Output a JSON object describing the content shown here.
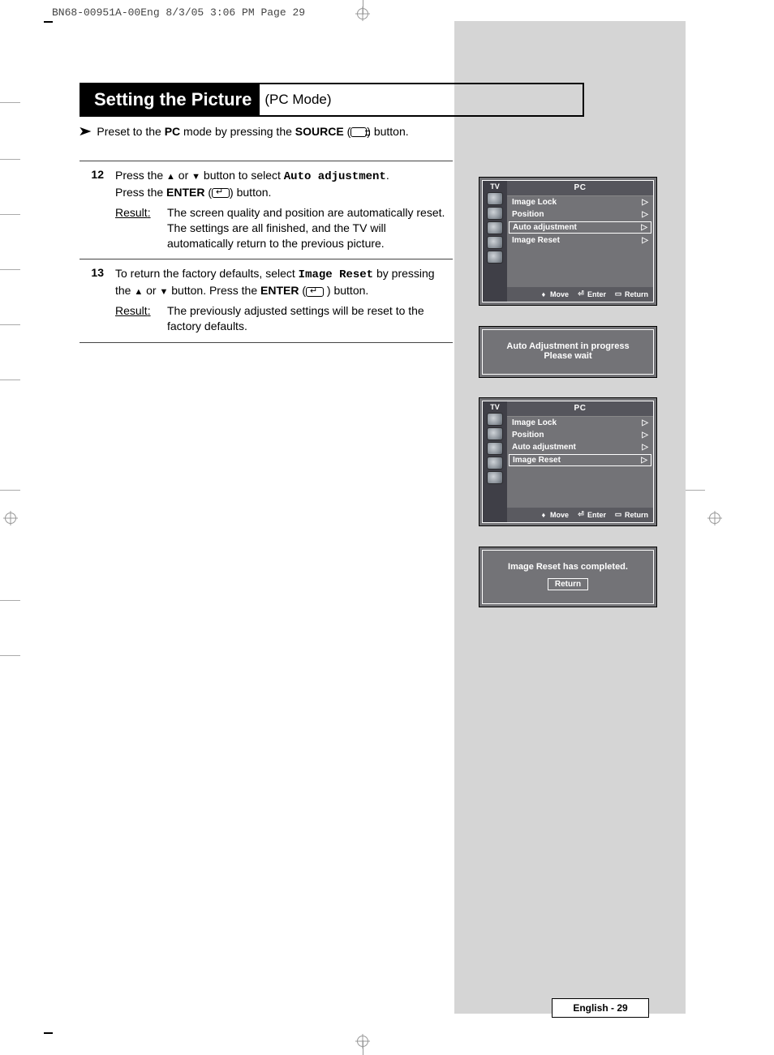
{
  "proof_header": "BN68-00951A-00Eng  8/3/05  3:06 PM  Page 29",
  "title": {
    "main": "Setting the Picture",
    "sub": "(PC Mode)"
  },
  "preset_line": {
    "pre": "Preset to the ",
    "pc": "PC",
    "mid": " mode by pressing the ",
    "src": "SOURCE",
    "post": " button."
  },
  "steps": [
    {
      "num": "12",
      "line1_a": "Press the ",
      "line1_b": " or ",
      "line1_c": " button to select ",
      "line1_mono": "Auto adjustment",
      "line1_d": ".",
      "line2_a": "Press the ",
      "line2_b": "ENTER",
      "line2_c": " button.",
      "result_label": "Result",
      "result_text": "The screen quality and position are automatically reset. The settings are all finished, and the TV will automatically return to the previous picture."
    },
    {
      "num": "13",
      "line1_a": "To return the factory defaults, select ",
      "line1_mono": "Image Reset",
      "line1_b": " by pressing the ",
      "line1_c": " or ",
      "line1_d": " button. Press the ",
      "line1_e": "ENTER",
      "line1_f": " button.",
      "result_label": "Result",
      "result_text": "The previously adjusted settings will be reset to the factory defaults."
    }
  ],
  "osd": {
    "tv": "TV",
    "title": "PC",
    "items": [
      "Image Lock",
      "Position",
      "Auto adjustment",
      "Image Reset"
    ],
    "chev": "▷",
    "foot_move": "Move",
    "foot_enter": "Enter",
    "foot_return": "Return"
  },
  "msg_auto": {
    "l1": "Auto Adjustment in progress",
    "l2": "Please wait"
  },
  "msg_reset": {
    "l1": "Image Reset has completed.",
    "btn": "Return"
  },
  "page_num": "English - 29"
}
